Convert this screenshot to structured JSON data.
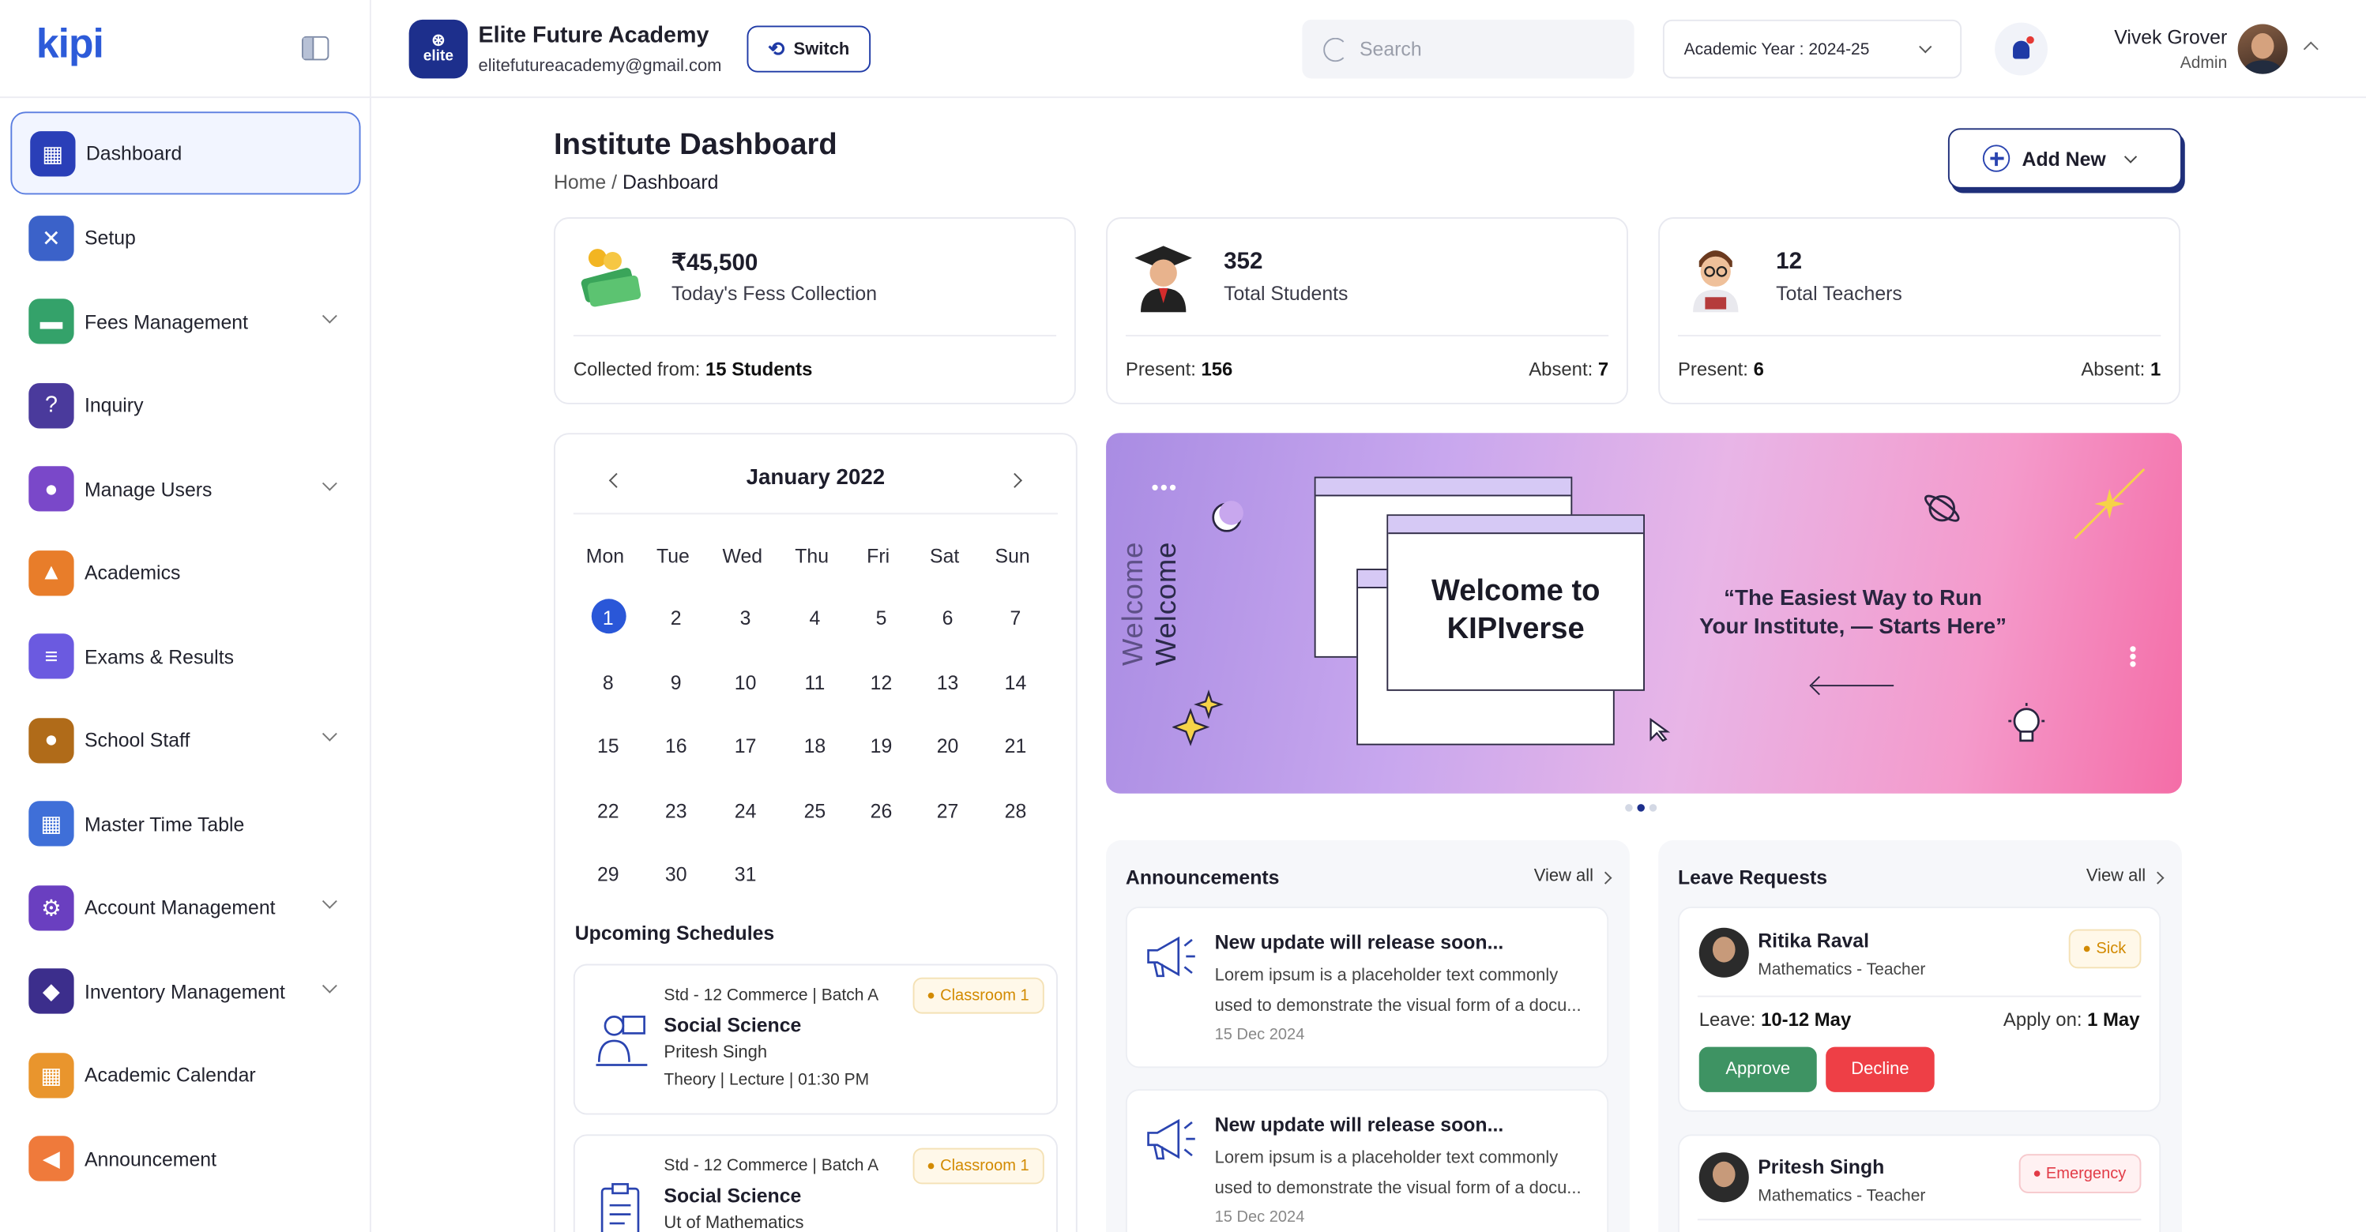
{
  "brand": {
    "logo_text": "kipi"
  },
  "sidebar": {
    "items": [
      {
        "label": "Dashboard",
        "icon": "dashboard-icon",
        "color": "#2a3fb8",
        "glyph": "▦",
        "expandable": false
      },
      {
        "label": "Setup",
        "icon": "tools-icon",
        "color": "#3b62c9",
        "glyph": "✕",
        "expandable": false
      },
      {
        "label": "Fees Management",
        "icon": "money-icon",
        "color": "#34a26a",
        "glyph": "▬",
        "expandable": true
      },
      {
        "label": "Inquiry",
        "icon": "inquiry-icon",
        "color": "#4a3a9c",
        "glyph": "?",
        "expandable": false
      },
      {
        "label": "Manage Users",
        "icon": "users-icon",
        "color": "#7a48c9",
        "glyph": "●",
        "expandable": true
      },
      {
        "label": "Academics",
        "icon": "graduation-cap-icon",
        "color": "#e87d2a",
        "glyph": "▲",
        "expandable": false
      },
      {
        "label": "Exams & Results",
        "icon": "exam-icon",
        "color": "#6b5ae0",
        "glyph": "≡",
        "expandable": false
      },
      {
        "label": "School Staff",
        "icon": "staff-icon",
        "color": "#b06b19",
        "glyph": "●",
        "expandable": true
      },
      {
        "label": "Master Time Table",
        "icon": "timetable-icon",
        "color": "#3f6fd8",
        "glyph": "▦",
        "expandable": false
      },
      {
        "label": "Account Management",
        "icon": "account-settings-icon",
        "color": "#6a3fc0",
        "glyph": "⚙",
        "expandable": true
      },
      {
        "label": "Inventory Management",
        "icon": "inventory-icon",
        "color": "#3c2e8c",
        "glyph": "◆",
        "expandable": true
      },
      {
        "label": "Academic Calendar",
        "icon": "calendar-icon",
        "color": "#e9952d",
        "glyph": "▦",
        "expandable": false
      },
      {
        "label": "Announcement",
        "icon": "megaphone-icon",
        "color": "#ef7a3b",
        "glyph": "◀",
        "expandable": false
      }
    ]
  },
  "header": {
    "institute_logo_text": "elite",
    "institute_name": "Elite Future Academy",
    "institute_email": "elitefutureacademy@gmail.com",
    "switch_label": "Switch",
    "search_placeholder": "Search",
    "academic_year": "Academic Year : 2024-25",
    "user_name": "Vivek Grover",
    "user_role": "Admin"
  },
  "page": {
    "title": "Institute Dashboard",
    "breadcrumb_home": "Home",
    "breadcrumb_sep": " / ",
    "breadcrumb_current": "Dashboard",
    "add_new_label": "Add New"
  },
  "stats": {
    "fees": {
      "value": "₹45,500",
      "label": "Today's Fess Collection",
      "footer_label": "Collected from: ",
      "footer_value": "15 Students"
    },
    "students": {
      "value": "352",
      "label": "Total Students",
      "present_label": "Present: ",
      "present": "156",
      "absent_label": "Absent: ",
      "absent": "7"
    },
    "teachers": {
      "value": "12",
      "label": "Total Teachers",
      "present_label": "Present: ",
      "present": "6",
      "absent_label": "Absent: ",
      "absent": "1"
    }
  },
  "calendar": {
    "month": "January 2022",
    "weekdays": [
      "Mon",
      "Tue",
      "Wed",
      "Thu",
      "Fri",
      "Sat",
      "Sun"
    ],
    "days": [
      "1",
      "2",
      "3",
      "4",
      "5",
      "6",
      "7",
      "8",
      "9",
      "10",
      "11",
      "12",
      "13",
      "14",
      "15",
      "16",
      "17",
      "18",
      "19",
      "20",
      "21",
      "22",
      "23",
      "24",
      "25",
      "26",
      "27",
      "28",
      "29",
      "30",
      "31"
    ],
    "selected": "1"
  },
  "schedules": {
    "title": "Upcoming Schedules",
    "items": [
      {
        "meta": "Std - 12 Commerce | Batch A",
        "subject": "Social Science",
        "teacher": "Pritesh Singh",
        "time": "Theory  |  Lecture  |  01:30 PM",
        "room": "Classroom 1"
      },
      {
        "meta": "Std - 12 Commerce | Batch A",
        "subject": "Social Science",
        "teacher": "Ut of Mathematics",
        "time": "",
        "room": "Classroom 1"
      }
    ]
  },
  "banner": {
    "vertical_text": "Welcome",
    "vertical_text_2": "Welcome",
    "title_line1": "Welcome to",
    "title_line2": "KIPIverse",
    "quote_line1": "“The Easiest Way to Run",
    "quote_line2": "Your Institute, — Starts Here”"
  },
  "announcements": {
    "title": "Announcements",
    "view_all": "View all",
    "items": [
      {
        "title": "New update will release soon...",
        "body": "Lorem ipsum is a placeholder text commonly used to demonstrate the visual form of a docu...",
        "date": "15 Dec 2024"
      },
      {
        "title": "New update will release soon...",
        "body": "Lorem ipsum is a placeholder text commonly used to demonstrate the visual form of a docu...",
        "date": "15 Dec 2024"
      }
    ]
  },
  "leave_requests": {
    "title": "Leave Requests",
    "view_all": "View all",
    "items": [
      {
        "name": "Ritika Raval",
        "role": "Mathematics - Teacher",
        "type": "Sick",
        "leave_label": "Leave: ",
        "leave": "10-12 May",
        "apply_label": "Apply on: ",
        "apply": "1 May",
        "approve": "Approve",
        "decline": "Decline"
      },
      {
        "name": "Pritesh Singh",
        "role": "Mathematics - Teacher",
        "type": "Emergency"
      }
    ]
  },
  "colors": {
    "primary": "#1d2f8c",
    "accent": "#2a57d8",
    "approve": "#3e9363",
    "decline": "#ee3f46",
    "warning": "#d28a00"
  }
}
